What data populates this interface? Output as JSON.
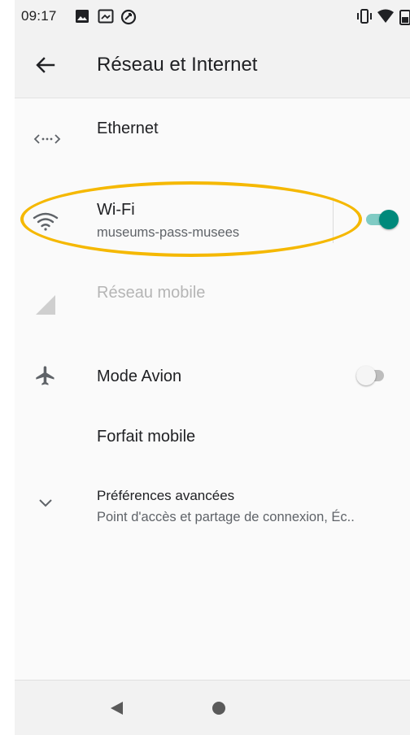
{
  "status_bar": {
    "time": "09:17",
    "icons": [
      "image-icon",
      "cast-icon",
      "sync-icon",
      "vibrate-icon",
      "wifi-status-icon",
      "battery-icon"
    ]
  },
  "app_bar": {
    "title": "Réseau et Internet",
    "back_icon": "arrow-back-icon"
  },
  "settings": {
    "ethernet": {
      "title": "Ethernet",
      "icon": "ethernet-icon"
    },
    "wifi": {
      "title": "Wi-Fi",
      "subtitle": "museums-pass-musees",
      "icon": "wifi-icon",
      "enabled": true
    },
    "mobile_network": {
      "title": "Réseau mobile",
      "icon": "signal-icon",
      "disabled": true
    },
    "airplane": {
      "title": "Mode Avion",
      "icon": "airplane-icon",
      "enabled": false
    },
    "data_plan": {
      "title": "Forfait mobile"
    },
    "advanced": {
      "title": "Préférences avancées",
      "subtitle": "Point d'accès et partage de connexion, Éc..",
      "icon": "chevron-down-icon"
    }
  },
  "colors": {
    "accent": "#00897b",
    "accent_track": "#80cbc4",
    "highlight": "#f5b800"
  },
  "nav_bar": {
    "icons": [
      "back-triangle-icon",
      "home-circle-icon"
    ]
  }
}
